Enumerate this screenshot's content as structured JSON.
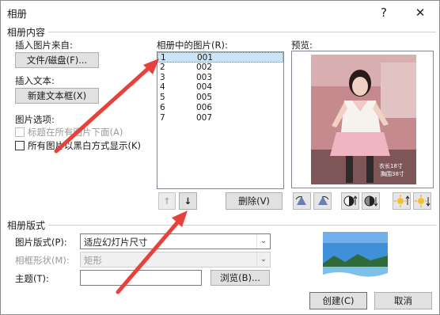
{
  "window": {
    "title": "相册",
    "help": "?",
    "close": "✕"
  },
  "album_content": {
    "section_label": "相册内容",
    "insert_from_label": "插入图片来自:",
    "file_disk_button": "文件/磁盘(F)...",
    "insert_text_label": "插入文本:",
    "new_textbox_button": "新建文本框(X)",
    "picture_options_label": "图片选项:",
    "caption_below_label": "标题在所有图片下面(A)",
    "black_white_label": "所有图片以黑白方式显示(K)",
    "caption_below_checked": false,
    "black_white_checked": false,
    "pictures_list_label": "相册中的图片(R):",
    "pictures": [
      {
        "num": "1",
        "name": "001"
      },
      {
        "num": "2",
        "name": "002"
      },
      {
        "num": "3",
        "name": "003"
      },
      {
        "num": "4",
        "name": "004"
      },
      {
        "num": "5",
        "name": "005"
      },
      {
        "num": "6",
        "name": "006"
      },
      {
        "num": "7",
        "name": "007"
      }
    ],
    "selected_index": 0,
    "move_up_icon": "↑",
    "move_down_icon": "↓",
    "remove_button": "删除(V)",
    "preview_label": "预览:",
    "photo_caption_1": "衣长18寸",
    "photo_caption_2": "胸围38寸"
  },
  "album_layout": {
    "section_label": "相册版式",
    "picture_layout_label": "图片版式(P):",
    "picture_layout_value": "适应幻灯片尺寸",
    "frame_shape_label": "相框形状(M):",
    "frame_shape_value": "矩形",
    "theme_label": "主题(T):",
    "theme_value": "",
    "browse_button": "浏览(B)..."
  },
  "footer": {
    "create_button": "创建(C)",
    "cancel_button": "取消"
  },
  "colors": {
    "arrow_red": "#e8403a",
    "selection_bg": "#cce4f7",
    "preview_photo": "#c98d8f"
  }
}
